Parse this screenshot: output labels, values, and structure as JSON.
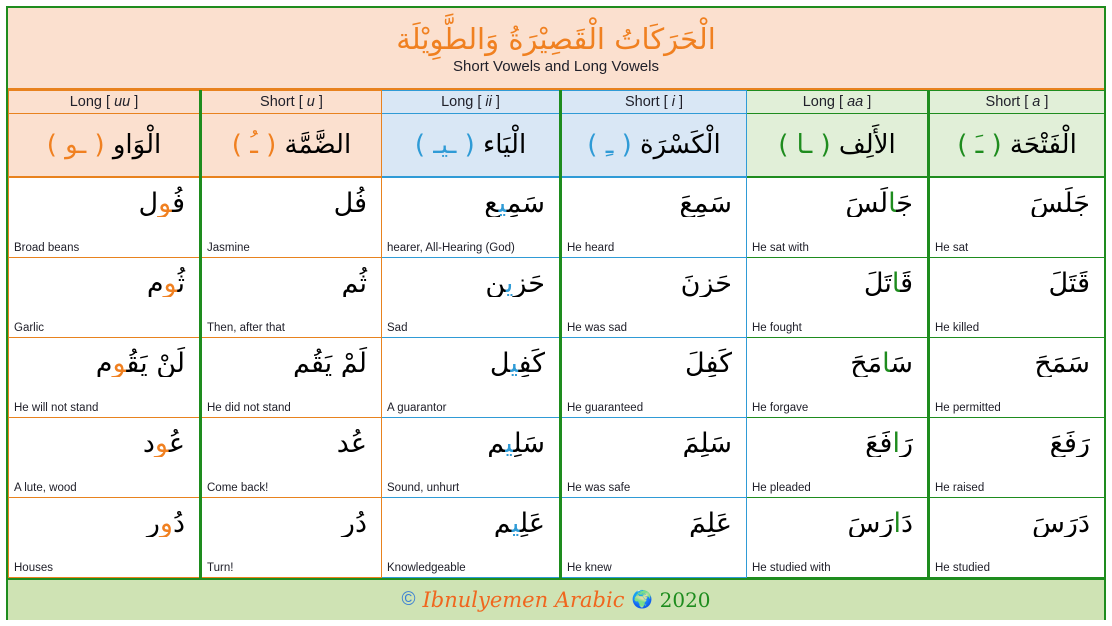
{
  "title": {
    "arabic": "الْحَرَكَاتُ الْقَصِيْرَةُ وَالطَّوِيْلَة",
    "english": "Short Vowels and Long Vowels"
  },
  "columns": [
    {
      "key": "long_uu",
      "latin_prefix": "Long [ ",
      "latin_italic": "uu",
      "latin_suffix": " ]",
      "arabic_name": "الْوَاو",
      "arabic_sign": "( ـو )",
      "group": "orange"
    },
    {
      "key": "short_u",
      "latin_prefix": "Short [ ",
      "latin_italic": "u",
      "latin_suffix": " ]",
      "arabic_name": "الضَّمَّة",
      "arabic_sign": "( ـُ )",
      "group": "orange"
    },
    {
      "key": "long_ii",
      "latin_prefix": "Long [ ",
      "latin_italic": "ii",
      "latin_suffix": " ]",
      "arabic_name": "الْيَاء",
      "arabic_sign": "( ـيـ )",
      "group": "blue"
    },
    {
      "key": "short_i",
      "latin_prefix": "Short [ ",
      "latin_italic": "i",
      "latin_suffix": " ]",
      "arabic_name": "الْكَسْرَة",
      "arabic_sign": "( ـِ )",
      "group": "blue"
    },
    {
      "key": "long_aa",
      "latin_prefix": "Long [ ",
      "latin_italic": "aa",
      "latin_suffix": " ]",
      "arabic_name": "الأَلِف",
      "arabic_sign": "( ـا )",
      "group": "green"
    },
    {
      "key": "short_a",
      "latin_prefix": "Short [ ",
      "latin_italic": "a",
      "latin_suffix": " ]",
      "arabic_name": "الْفَتْحَة",
      "arabic_sign": "( ـَ )",
      "group": "green"
    }
  ],
  "rows": [
    {
      "long_uu": {
        "word": "فُول",
        "gloss": "Broad beans"
      },
      "short_u": {
        "word": "فُل",
        "gloss": "Jasmine"
      },
      "long_ii": {
        "word": "سَمِيع",
        "gloss": "hearer, All-Hearing (God)"
      },
      "short_i": {
        "word": "سَمِعَ",
        "gloss": "He heard"
      },
      "long_aa": {
        "word": "جَالَسَ",
        "gloss": "He sat with"
      },
      "short_a": {
        "word": "جَلَسَ",
        "gloss": "He sat"
      }
    },
    {
      "long_uu": {
        "word": "ثُوم",
        "gloss": "Garlic"
      },
      "short_u": {
        "word": "ثُم",
        "gloss": "Then, after that"
      },
      "long_ii": {
        "word": "حَزِين",
        "gloss": "Sad"
      },
      "short_i": {
        "word": "حَزِنَ",
        "gloss": "He was sad"
      },
      "long_aa": {
        "word": "قَاتَلَ",
        "gloss": "He fought"
      },
      "short_a": {
        "word": "قَتَلَ",
        "gloss": "He killed"
      }
    },
    {
      "long_uu": {
        "word": "لَنْ يَقُوم",
        "gloss": "He will not stand"
      },
      "short_u": {
        "word": "لَمْ يَقُم",
        "gloss": "He did not stand"
      },
      "long_ii": {
        "word": "كَفِيل",
        "gloss": "A guarantor"
      },
      "short_i": {
        "word": "كَفِلَ",
        "gloss": "He guaranteed"
      },
      "long_aa": {
        "word": "سَامَحَ",
        "gloss": "He forgave"
      },
      "short_a": {
        "word": "سَمَحَ",
        "gloss": "He permitted"
      }
    },
    {
      "long_uu": {
        "word": "عُود",
        "gloss": "A lute, wood"
      },
      "short_u": {
        "word": "عُد",
        "gloss": "Come back!"
      },
      "long_ii": {
        "word": "سَلِيم",
        "gloss": "Sound, unhurt"
      },
      "short_i": {
        "word": "سَلِمَ",
        "gloss": "He was safe"
      },
      "long_aa": {
        "word": "رَافَعَ",
        "gloss": "He pleaded"
      },
      "short_a": {
        "word": "رَفَعَ",
        "gloss": "He raised"
      }
    },
    {
      "long_uu": {
        "word": "دُور",
        "gloss": "Houses"
      },
      "short_u": {
        "word": "دُر",
        "gloss": "Turn!"
      },
      "long_ii": {
        "word": "عَلِيم",
        "gloss": "Knowledgeable"
      },
      "short_i": {
        "word": "عَلِمَ",
        "gloss": "He knew"
      },
      "long_aa": {
        "word": "دَارَسَ",
        "gloss": "He studied with"
      },
      "short_a": {
        "word": "دَرَسَ",
        "gloss": "He studied"
      }
    }
  ],
  "footer": {
    "copyright": "©",
    "name": "Ibnulyemen Arabic",
    "globe": "🌍",
    "year": "2020"
  },
  "colors": {
    "orange": "#e8821e",
    "orange_fill": "#fbe0cf",
    "blue": "#2f9bd6",
    "blue_fill": "#d9e7f5",
    "green": "#1e8c1e",
    "green_fill": "#e1efd8",
    "red_diacritic": "#e8241e",
    "title_orange": "#f08020"
  }
}
